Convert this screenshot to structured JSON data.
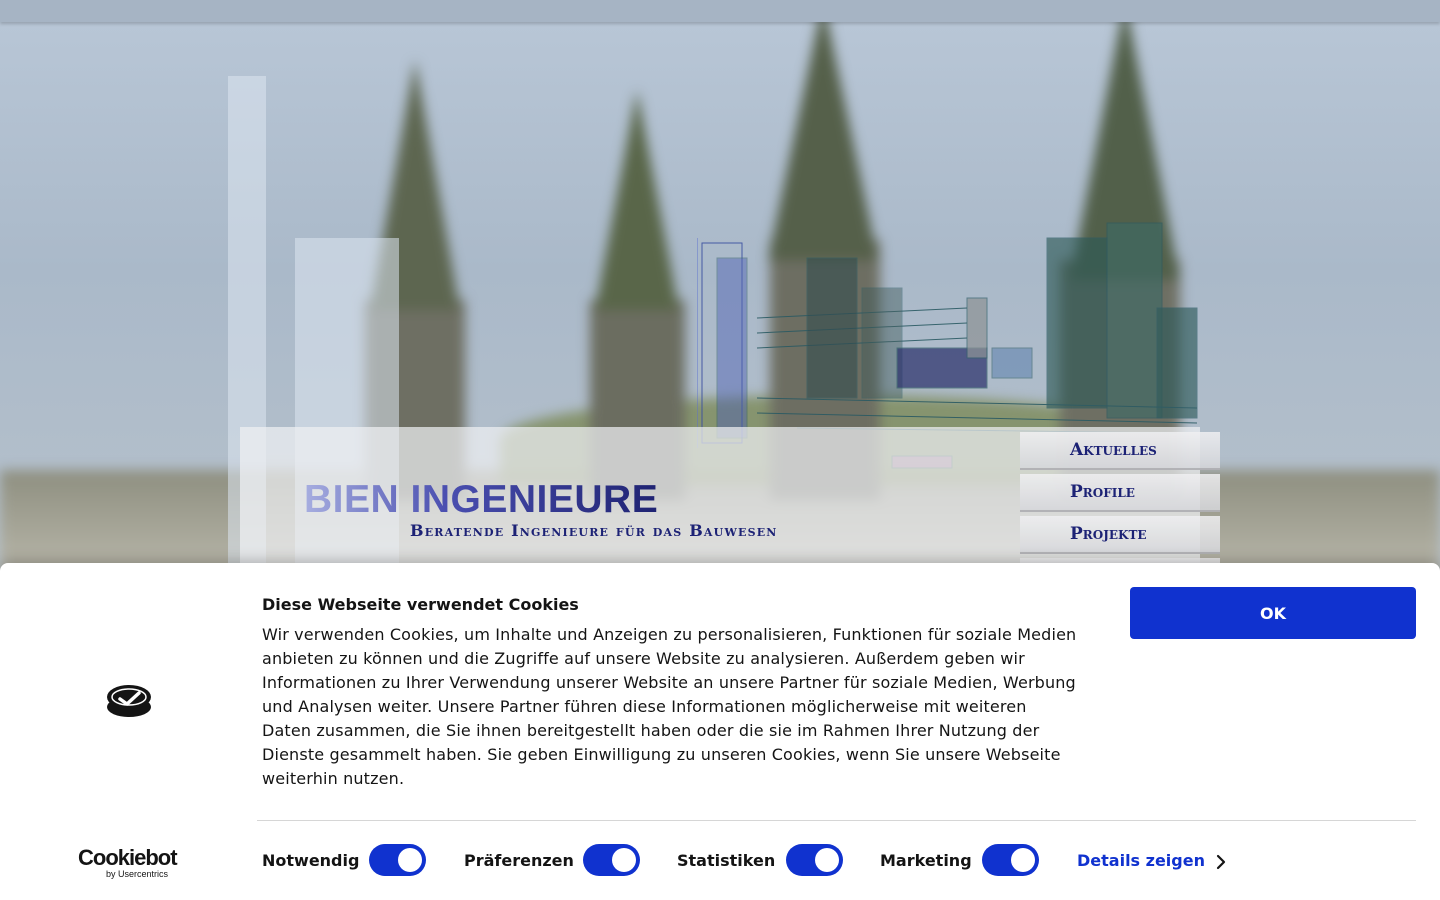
{
  "site": {
    "brand_name": "BIEN INGENIEURE",
    "tagline": "Beratende Ingenieure für das Bauwesen",
    "nav": [
      {
        "label": "Aktuelles"
      },
      {
        "label": "Profile"
      },
      {
        "label": "Projekte"
      },
      {
        "label": ""
      }
    ]
  },
  "cookie_banner": {
    "title": "Diese Webseite verwendet Cookies",
    "text": "Wir verwenden Cookies, um Inhalte und Anzeigen zu personalisieren, Funktionen für soziale Medien anbieten zu können und die Zugriffe auf unsere Website zu analysieren. Außerdem geben wir Informationen zu Ihrer Verwendung unserer Website an unsere Partner für soziale Medien, Werbung und Analysen weiter. Unsere Partner führen diese Informationen möglicherweise mit weiteren Daten zusammen, die Sie ihnen bereitgestellt haben oder die sie im Rahmen Ihrer Nutzung der Dienste gesammelt haben. Sie geben Einwilligung zu unseren Cookies, wenn Sie unsere Webseite weiterhin nutzen.",
    "ok_label": "OK",
    "provider": {
      "name": "Cookiebot",
      "by": "by Usercentrics"
    },
    "toggles": [
      {
        "label": "Notwendig",
        "on": true
      },
      {
        "label": "Präferenzen",
        "on": true
      },
      {
        "label": "Statistiken",
        "on": true
      },
      {
        "label": "Marketing",
        "on": true
      }
    ],
    "details_label": "Details zeigen",
    "accent_color": "#1032cf"
  }
}
